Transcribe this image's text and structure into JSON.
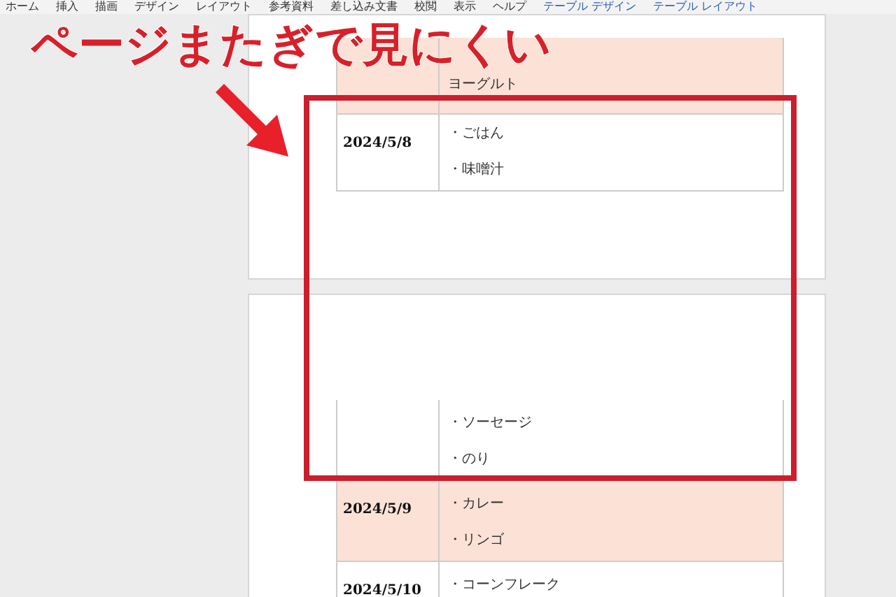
{
  "ribbon": {
    "tabs": [
      {
        "label": "ホーム",
        "kind": "core"
      },
      {
        "label": "挿入",
        "kind": "core"
      },
      {
        "label": "描画",
        "kind": "core"
      },
      {
        "label": "デザイン",
        "kind": "core"
      },
      {
        "label": "レイアウト",
        "kind": "core"
      },
      {
        "label": "参考資料",
        "kind": "core"
      },
      {
        "label": "差し込み文書",
        "kind": "core"
      },
      {
        "label": "校閲",
        "kind": "core"
      },
      {
        "label": "表示",
        "kind": "core"
      },
      {
        "label": "ヘルプ",
        "kind": "core"
      },
      {
        "label": "テーブル デザイン",
        "kind": "context"
      },
      {
        "label": "テーブル レイアウト",
        "kind": "context"
      }
    ]
  },
  "headline": "ページまたぎで見にくい",
  "pages": [
    {
      "rows": [
        {
          "shaded": true,
          "items": [
            "ヨーグルト"
          ]
        },
        {
          "shaded": false,
          "date": "2024/5/8",
          "items": [
            "・ごはん",
            "・味噌汁"
          ]
        }
      ]
    },
    {
      "rows": [
        {
          "shaded": false,
          "items": [
            "・ソーセージ",
            "・のり"
          ]
        },
        {
          "shaded": true,
          "date": "2024/5/9",
          "items": [
            "・カレー",
            "・リンゴ"
          ]
        },
        {
          "shaded": false,
          "date": "2024/5/10",
          "items": [
            "・コーンフレーク"
          ]
        }
      ]
    }
  ]
}
